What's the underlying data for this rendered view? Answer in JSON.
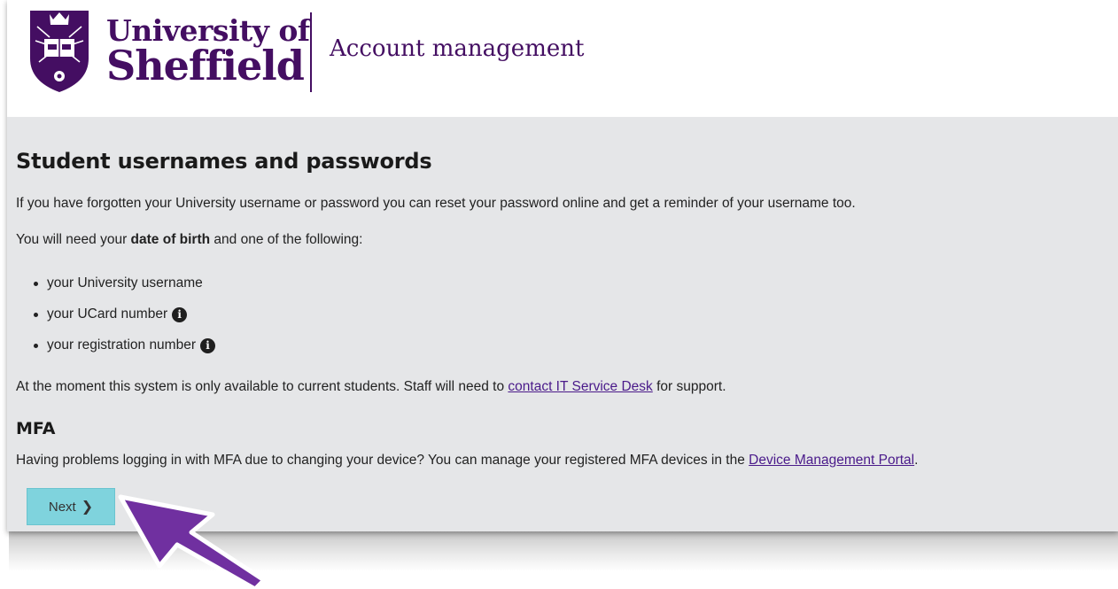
{
  "header": {
    "university_line1": "University of",
    "university_line2": "Sheffield",
    "site_title": "Account management"
  },
  "main": {
    "heading": "Student usernames and passwords",
    "intro": "If you have forgotten your University username or password you can reset your password online and get a reminder of your username too.",
    "need_prefix": "You will need your ",
    "need_bold": "date of birth",
    "need_suffix": " and one of the following:",
    "list": [
      "your University username",
      "your UCard number",
      "your registration number"
    ],
    "availability_prefix": "At the moment this system is only available to current students. Staff will need to ",
    "availability_link": "contact IT Service Desk",
    "availability_suffix": " for support.",
    "mfa_heading": "MFA",
    "mfa_prefix": "Having problems logging in with MFA due to changing your device? You can manage your registered MFA devices in the ",
    "mfa_link": "Device Management Portal",
    "mfa_suffix": ".",
    "next_label": "Next"
  },
  "colors": {
    "brand_purple": "#440e62",
    "button_teal": "#7fd3dd",
    "arrow_purple": "#7030a0",
    "page_background": "#e5e6e8"
  },
  "icons": {
    "info": "info-circle-icon",
    "next": "chevron-right-icon",
    "pointer": "pointer-arrow-icon",
    "crest": "university-crest-icon"
  }
}
